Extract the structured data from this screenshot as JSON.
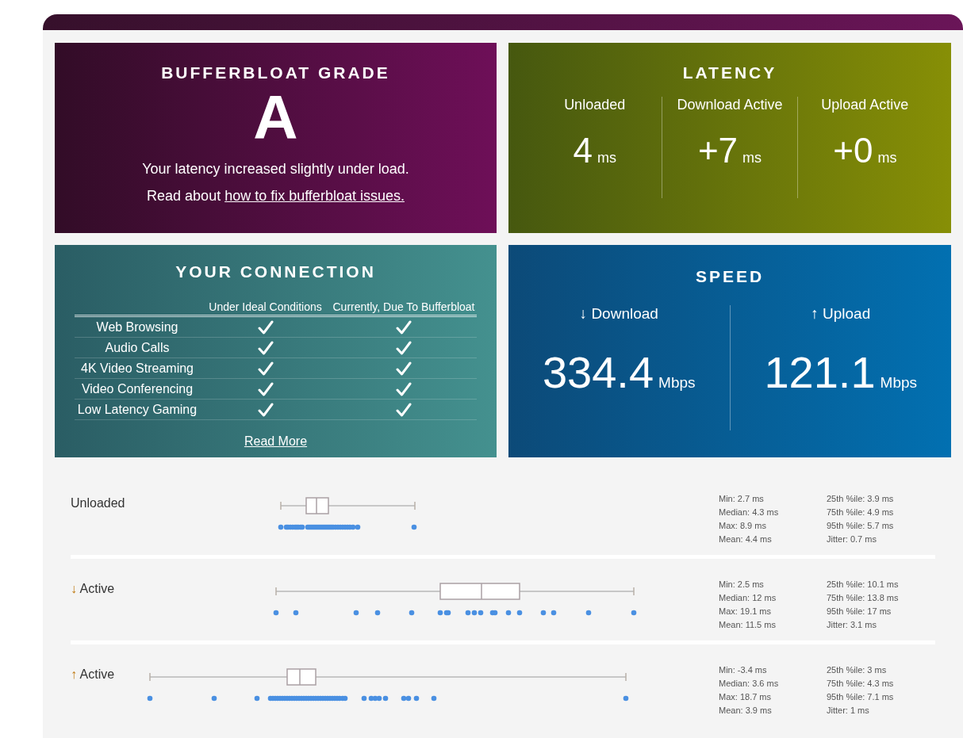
{
  "grade": {
    "title": "BUFFERBLOAT GRADE",
    "grade": "A",
    "message": "Your latency increased slightly under load.",
    "read_about": "Read about",
    "link": "how to fix bufferbloat issues."
  },
  "latency": {
    "title": "LATENCY",
    "columns": [
      {
        "label": "Unloaded",
        "value": "4",
        "unit": "ms"
      },
      {
        "label": "Download Active",
        "value": "+7",
        "unit": "ms"
      },
      {
        "label": "Upload Active",
        "value": "+0",
        "unit": "ms"
      }
    ]
  },
  "connection": {
    "title": "YOUR CONNECTION",
    "columns": [
      "Under Ideal Conditions",
      "Currently, Due To Bufferbloat"
    ],
    "rows": [
      {
        "name": "Web Browsing",
        "ideal": true,
        "current": true
      },
      {
        "name": "Audio Calls",
        "ideal": true,
        "current": true
      },
      {
        "name": "4K Video Streaming",
        "ideal": true,
        "current": true
      },
      {
        "name": "Video Conferencing",
        "ideal": true,
        "current": true
      },
      {
        "name": "Low Latency Gaming",
        "ideal": true,
        "current": true
      }
    ],
    "read_more": "Read More"
  },
  "speed": {
    "title": "SPEED",
    "columns": [
      {
        "arrow": "↓",
        "label": "Download",
        "value": "334.4",
        "unit": "Mbps"
      },
      {
        "arrow": "↑",
        "label": "Upload",
        "value": "121.1",
        "unit": "Mbps"
      }
    ]
  },
  "latency_details": [
    {
      "label": "Unloaded",
      "stats_left": [
        "Min: 2.7 ms",
        "Median: 4.3 ms",
        "Max: 8.9 ms",
        "Mean: 4.4 ms"
      ],
      "stats_right": [
        "25th %ile: 3.9 ms",
        "75th %ile: 4.9 ms",
        "95th %ile: 5.7 ms",
        "Jitter: 0.7 ms"
      ]
    },
    {
      "arrow": "↓",
      "label": "Active",
      "stats_left": [
        "Min: 2.5 ms",
        "Median: 12 ms",
        "Max: 19.1 ms",
        "Mean: 11.5 ms"
      ],
      "stats_right": [
        "25th %ile: 10.1 ms",
        "75th %ile: 13.8 ms",
        "95th %ile: 17 ms",
        "Jitter: 3.1 ms"
      ]
    },
    {
      "arrow": "↑",
      "label": "Active",
      "stats_left": [
        "Min: -3.4 ms",
        "Median: 3.6 ms",
        "Max: 18.7 ms",
        "Mean: 3.9 ms"
      ],
      "stats_right": [
        "25th %ile: 3 ms",
        "75th %ile: 4.3 ms",
        "95th %ile: 7.1 ms",
        "Jitter: 1 ms"
      ]
    }
  ]
}
